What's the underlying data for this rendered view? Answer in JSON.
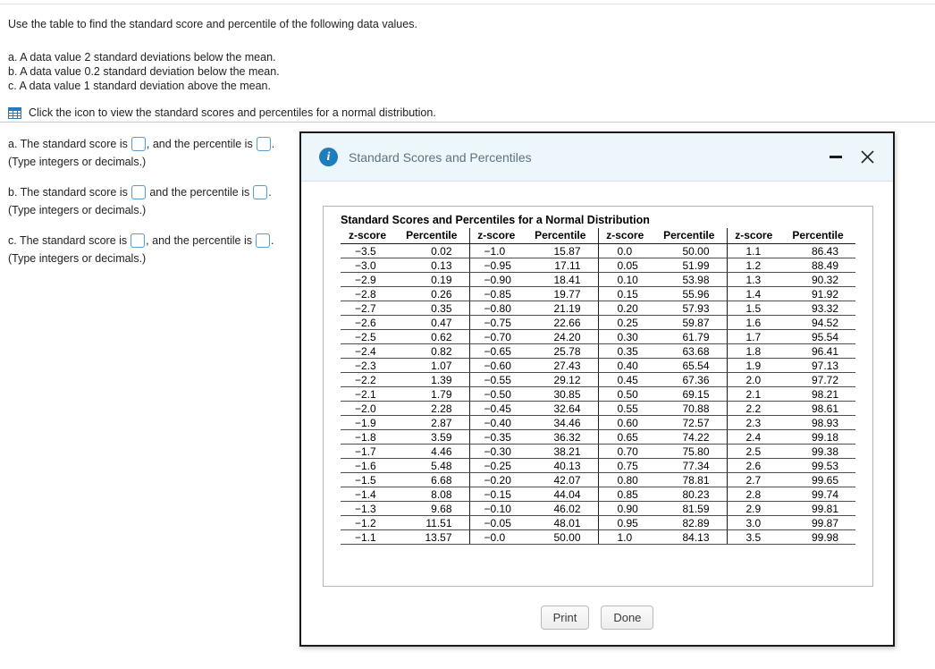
{
  "question": {
    "intro": "Use the table to find the standard score and percentile of the following data values.",
    "items": [
      "a. A data value 2 standard deviations below the mean.",
      "b. A data value 0.2 standard deviation below the mean.",
      "c. A data value 1 standard deviation above the mean."
    ],
    "icon_hint": "Click the icon to view the standard scores and percentiles for a normal distribution."
  },
  "answers": [
    {
      "label": "a. The standard score is",
      "conjunction": ", and the percentile is",
      "end": ".",
      "note": "(Type integers or decimals.)"
    },
    {
      "label": "b. The standard score is",
      "conjunction": " and the percentile is",
      "end": ".",
      "note": "(Type integers or decimals.)"
    },
    {
      "label": "c. The standard score is",
      "conjunction": ", and the percentile is",
      "end": ".",
      "note": "(Type integers or decimals.)"
    }
  ],
  "dialog": {
    "title": "Standard Scores and Percentiles",
    "icons": {
      "info": "i"
    },
    "buttons": {
      "print": "Print",
      "done": "Done"
    },
    "table": {
      "title": "Standard Scores and Percentiles for a Normal Distribution",
      "headers": [
        "z-score",
        "Percentile",
        "z-score",
        "Percentile",
        "z-score",
        "Percentile",
        "z-score",
        "Percentile"
      ],
      "rows": [
        [
          "−3.5",
          "0.02",
          "−1.0",
          "15.87",
          "0.0",
          "50.00",
          "1.1",
          "86.43"
        ],
        [
          "−3.0",
          "0.13",
          "−0.95",
          "17.11",
          "0.05",
          "51.99",
          "1.2",
          "88.49"
        ],
        [
          "−2.9",
          "0.19",
          "−0.90",
          "18.41",
          "0.10",
          "53.98",
          "1.3",
          "90.32"
        ],
        [
          "−2.8",
          "0.26",
          "−0.85",
          "19.77",
          "0.15",
          "55.96",
          "1.4",
          "91.92"
        ],
        [
          "−2.7",
          "0.35",
          "−0.80",
          "21.19",
          "0.20",
          "57.93",
          "1.5",
          "93.32"
        ],
        [
          "−2.6",
          "0.47",
          "−0.75",
          "22.66",
          "0.25",
          "59.87",
          "1.6",
          "94.52"
        ],
        [
          "−2.5",
          "0.62",
          "−0.70",
          "24.20",
          "0.30",
          "61.79",
          "1.7",
          "95.54"
        ],
        [
          "−2.4",
          "0.82",
          "−0.65",
          "25.78",
          "0.35",
          "63.68",
          "1.8",
          "96.41"
        ],
        [
          "−2.3",
          "1.07",
          "−0.60",
          "27.43",
          "0.40",
          "65.54",
          "1.9",
          "97.13"
        ],
        [
          "−2.2",
          "1.39",
          "−0.55",
          "29.12",
          "0.45",
          "67.36",
          "2.0",
          "97.72"
        ],
        [
          "−2.1",
          "1.79",
          "−0.50",
          "30.85",
          "0.50",
          "69.15",
          "2.1",
          "98.21"
        ],
        [
          "−2.0",
          "2.28",
          "−0.45",
          "32.64",
          "0.55",
          "70.88",
          "2.2",
          "98.61"
        ],
        [
          "−1.9",
          "2.87",
          "−0.40",
          "34.46",
          "0.60",
          "72.57",
          "2.3",
          "98.93"
        ],
        [
          "−1.8",
          "3.59",
          "−0.35",
          "36.32",
          "0.65",
          "74.22",
          "2.4",
          "99.18"
        ],
        [
          "−1.7",
          "4.46",
          "−0.30",
          "38.21",
          "0.70",
          "75.80",
          "2.5",
          "99.38"
        ],
        [
          "−1.6",
          "5.48",
          "−0.25",
          "40.13",
          "0.75",
          "77.34",
          "2.6",
          "99.53"
        ],
        [
          "−1.5",
          "6.68",
          "−0.20",
          "42.07",
          "0.80",
          "78.81",
          "2.7",
          "99.65"
        ],
        [
          "−1.4",
          "8.08",
          "−0.15",
          "44.04",
          "0.85",
          "80.23",
          "2.8",
          "99.74"
        ],
        [
          "−1.3",
          "9.68",
          "−0.10",
          "46.02",
          "0.90",
          "81.59",
          "2.9",
          "99.81"
        ],
        [
          "−1.2",
          "11.51",
          "−0.05",
          "48.01",
          "0.95",
          "82.89",
          "3.0",
          "99.87"
        ],
        [
          "−1.1",
          "13.57",
          "−0.0",
          "50.00",
          "1.0",
          "84.13",
          "3.5",
          "99.98"
        ]
      ]
    }
  },
  "colors": {
    "accent_blue": "#1e7dbb",
    "dialog_header_bg": "#edf6fb",
    "input_border": "#5e9fcd",
    "table_icon_blue": "#2f76b3"
  }
}
